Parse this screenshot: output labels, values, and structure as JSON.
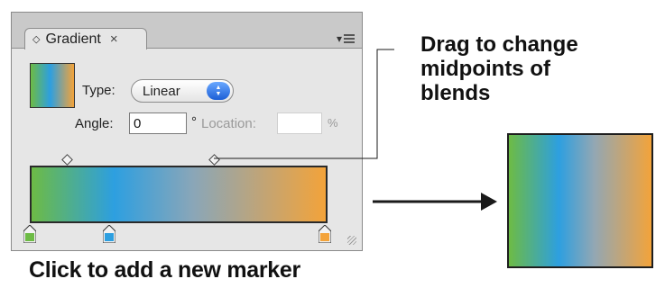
{
  "panel": {
    "tab_title": "Gradient",
    "tab_diamond": "◇",
    "tab_close": "×",
    "menu_arrow": "▾",
    "type_label": "Type:",
    "type_value": "Linear",
    "angle_label": "Angle:",
    "angle_value": "0",
    "degree_mark": "°",
    "location_label": "Location:",
    "location_value": "",
    "percent_label": "%",
    "stop_colors": [
      "#6dbb45",
      "#2d9fe0",
      "#f3a33a"
    ]
  },
  "annotations": {
    "midpoint_callout_line1": "Drag to change",
    "midpoint_callout_line2": "midpoints of",
    "midpoint_callout_line3": "blends",
    "marker_callout": "Click to add a new marker"
  },
  "colors": {
    "green": "#6dbb45",
    "blue": "#2d9fe0",
    "orange": "#f3a33a"
  }
}
